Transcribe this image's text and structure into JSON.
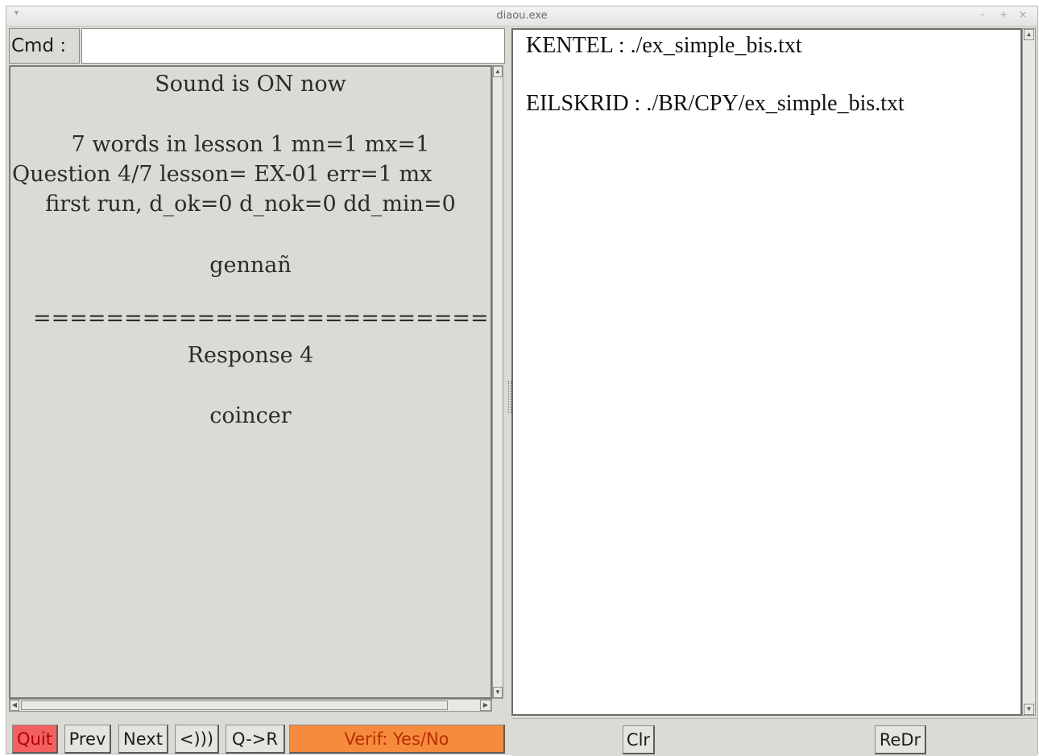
{
  "window": {
    "title": "diaou.exe",
    "controls": [
      "–",
      "+",
      "×"
    ]
  },
  "cmd": {
    "label": "Cmd :",
    "value": ""
  },
  "question": {
    "lines": [
      "Sound is ON now",
      "7  words in lesson  1 mn=1 mx=1",
      "Question  4/7  lesson= EX-01   err=1   mx",
      "first run, d_ok=0  d_nok=0  dd_min=0",
      "gennañ",
      "=====================================",
      "Response  4",
      "coincer"
    ]
  },
  "buttons": {
    "quit": "Quit",
    "prev": "Prev",
    "next": "Next",
    "sound": "<)))",
    "q_to_r": "Q->R",
    "verif": "Verif: Yes/No",
    "clr": "Clr",
    "redr": "ReDr"
  },
  "log": {
    "lines": [
      "KENTEL : ./ex_simple_bis.txt",
      "EILSKRID : ./BR/CPY/ex_simple_bis.txt"
    ]
  },
  "colors": {
    "quit_bg": "#f26060",
    "verif_bg": "#f68a3d",
    "panel_bg": "#dcdad5"
  }
}
